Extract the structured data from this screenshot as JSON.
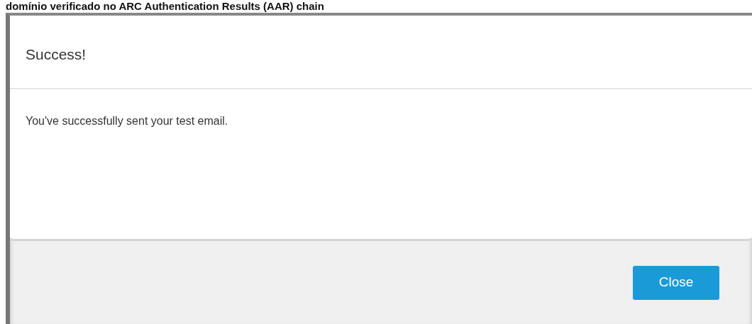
{
  "page_heading": "domínio verificado no ARC Authentication Results (AAR) chain",
  "dialog": {
    "title": "Success!",
    "message": "You've successfully sent your test email.",
    "buttons": [
      "Close"
    ]
  }
}
